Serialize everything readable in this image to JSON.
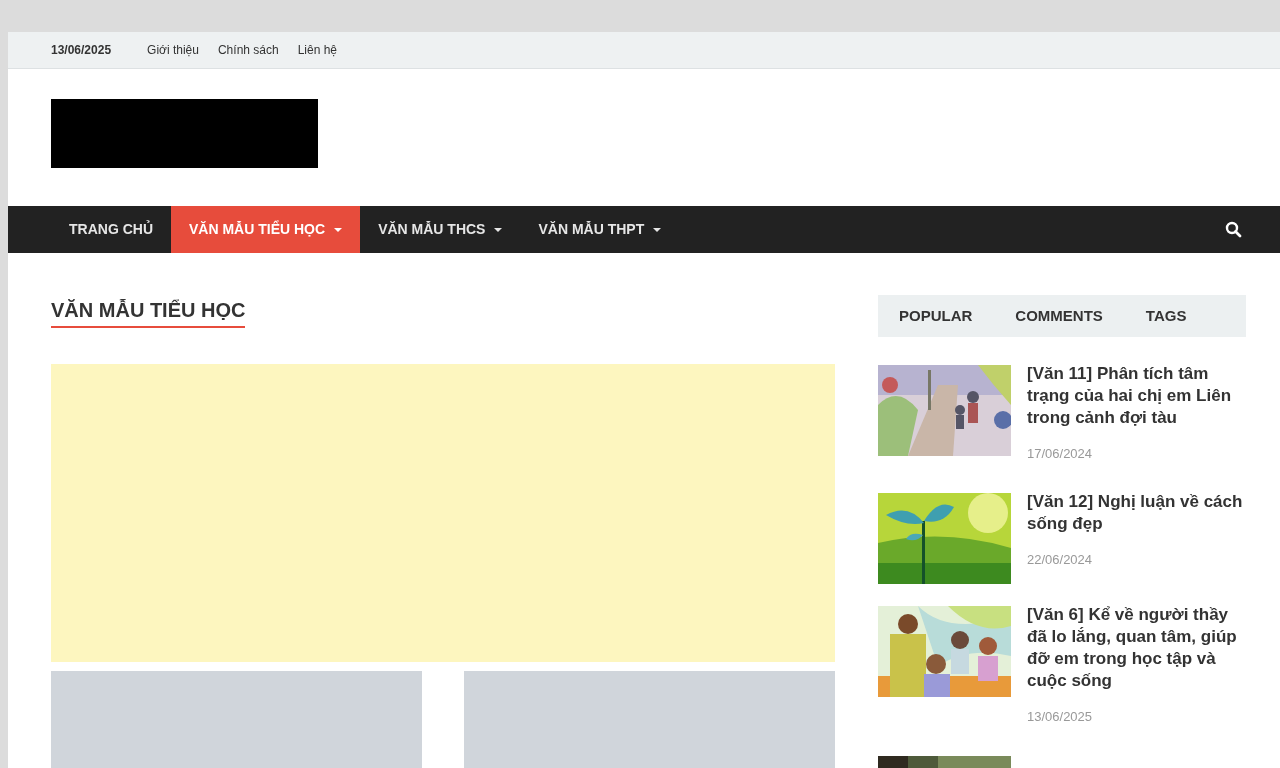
{
  "top_bar": {
    "date": "13/06/2025",
    "links": [
      "Giới thiệu",
      "Chính sách",
      "Liên hệ"
    ]
  },
  "nav": {
    "items": [
      {
        "label": "TRANG CHỦ",
        "selected": false,
        "dropdown": false
      },
      {
        "label": "VĂN MẪU TIỂU HỌC",
        "selected": true,
        "dropdown": true
      },
      {
        "label": "VĂN MẪU THCS",
        "selected": false,
        "dropdown": true
      },
      {
        "label": "VĂN MẪU THPT",
        "selected": false,
        "dropdown": true
      }
    ]
  },
  "section_title": "VĂN MẪU TIỂU HỌC",
  "sidebar": {
    "tabs": [
      "POPULAR",
      "COMMENTS",
      "TAGS"
    ],
    "posts": [
      {
        "title": "[Văn 11] Phân tích tâm trạng của hai chị em Liên trong cảnh đợi tàu",
        "date": "17/06/2024"
      },
      {
        "title": "[Văn 12] Nghị luận về cách sống đẹp",
        "date": "22/06/2024"
      },
      {
        "title": "[Văn 6] Kể về người thầy đã lo lắng, quan tâm, giúp đỡ em trong học tập và cuộc sống",
        "date": "13/06/2025"
      }
    ]
  }
}
